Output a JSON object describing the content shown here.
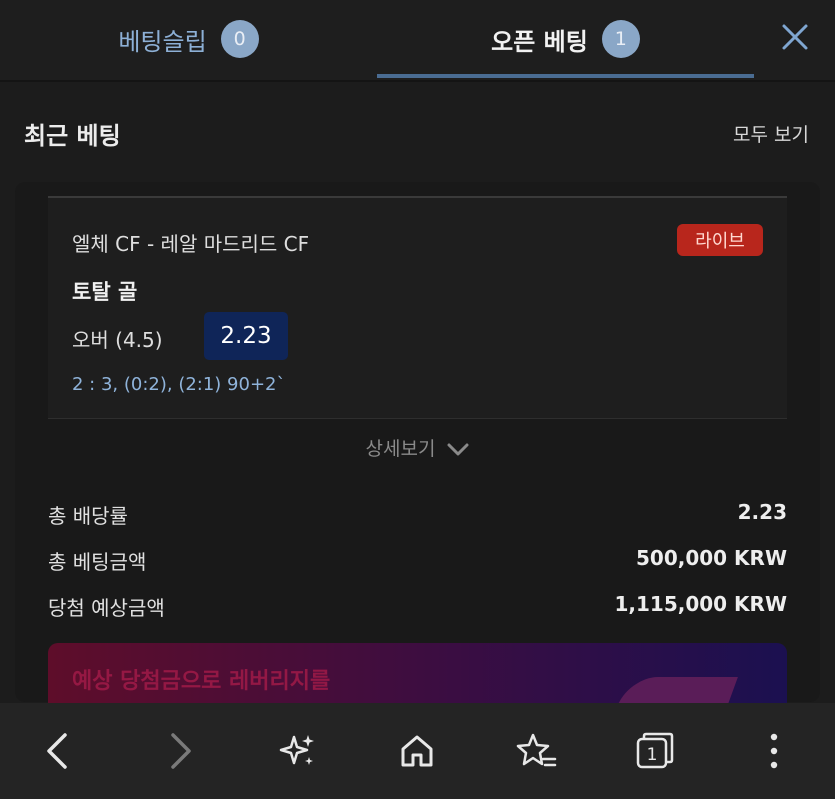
{
  "tabs": {
    "slip_label": "베팅슬립",
    "slip_count": "0",
    "open_label": "오픈 베팅",
    "open_count": "1"
  },
  "section": {
    "title": "최근 베팅",
    "view_all": "모두 보기"
  },
  "bet": {
    "match": "엘체 CF - 레알 마드리드 CF",
    "live_label": "라이브",
    "market": "토탈 골",
    "selection": "오버 (4.5)",
    "odds": "2.23",
    "score": "2 : 3, (0:2), (2:1) 90+2`"
  },
  "details_label": "상세보기",
  "summary": {
    "total_odds_label": "총 배당률",
    "total_odds_value": "2.23",
    "stake_label": "총 베팅금액",
    "stake_value": "500,000 KRW",
    "payout_label": "당첨 예상금액",
    "payout_value": "1,115,000 KRW"
  },
  "promo": {
    "text": "예상 당첨금으로 레버리지를"
  },
  "nav": {
    "tab_count": "1"
  },
  "colors": {
    "accent": "#4a6c92",
    "live": "#b8261c",
    "odds_bg": "#0f2558",
    "score_text": "#8fb3da"
  }
}
